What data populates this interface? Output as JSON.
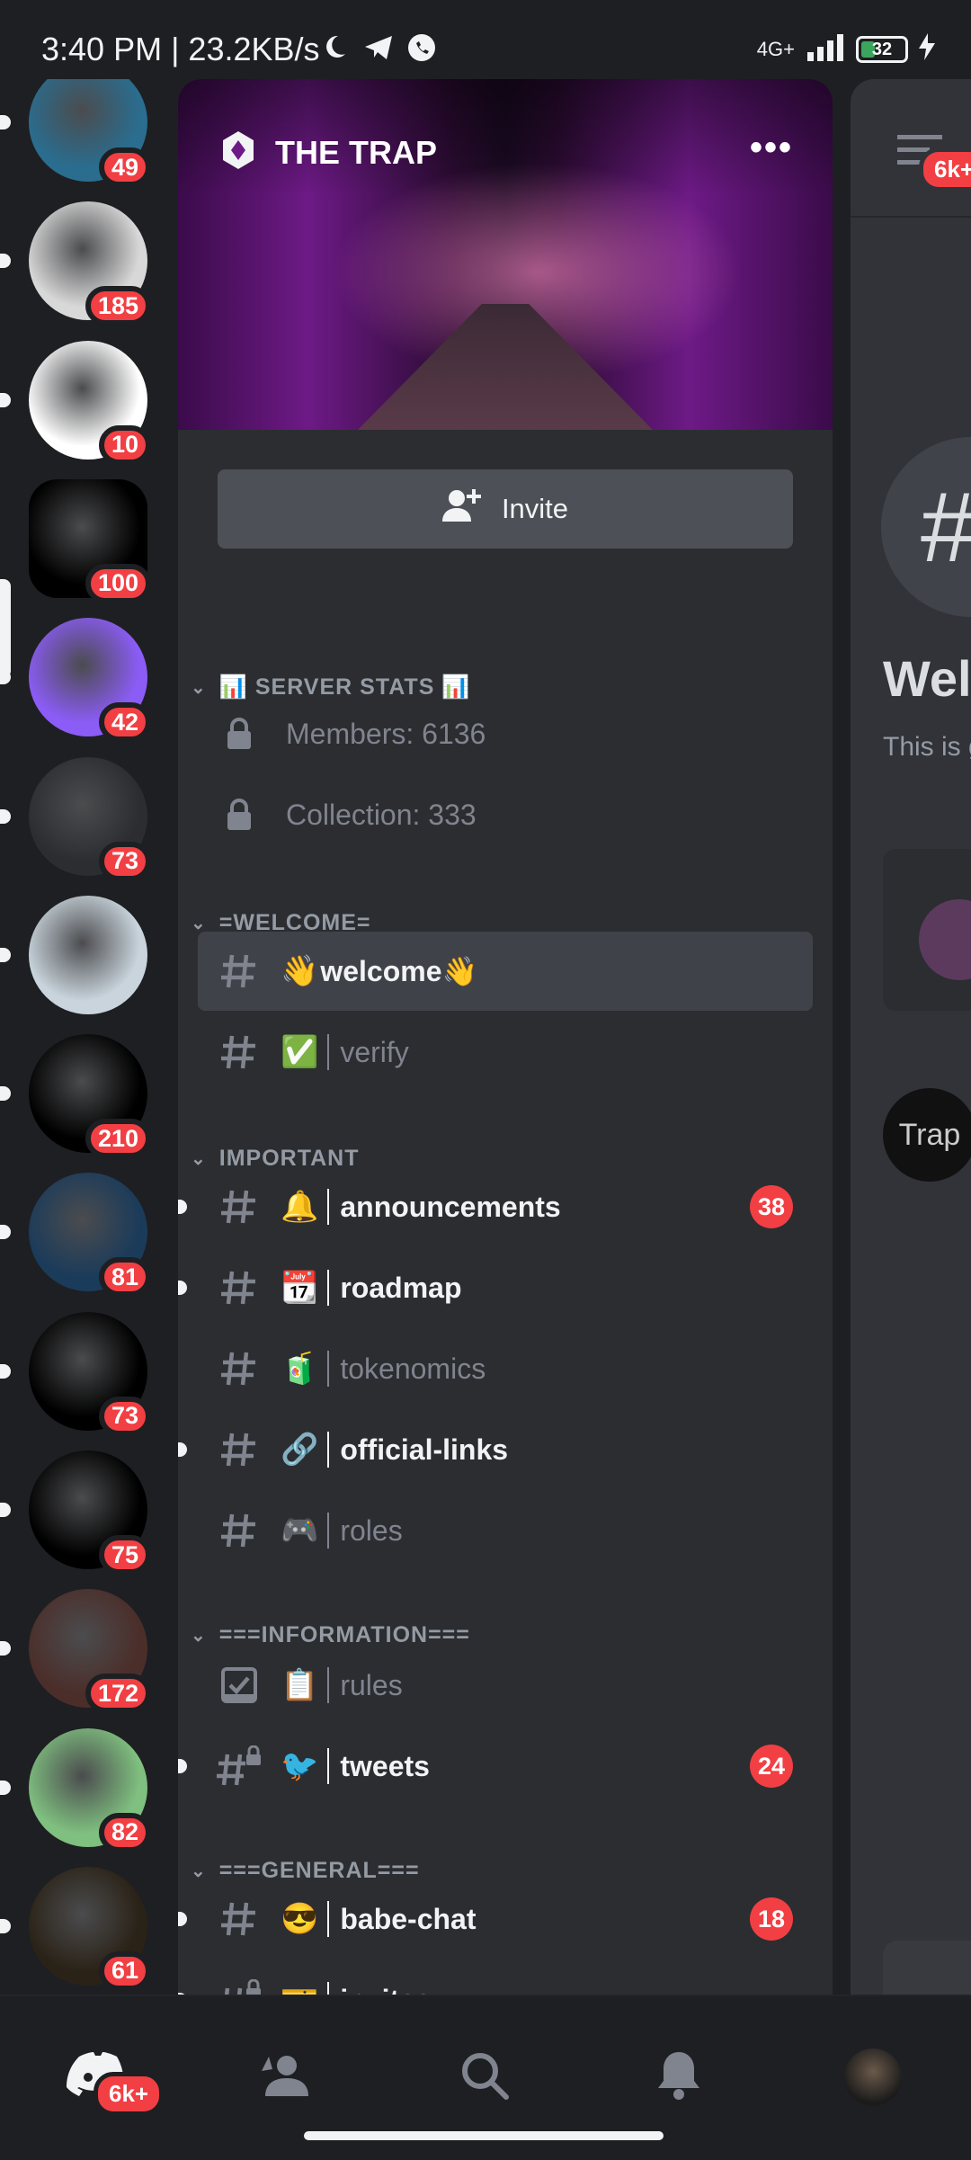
{
  "status_bar": {
    "time_speed": "3:40 PM | 23.2KB/s",
    "network": "4G+",
    "battery": "32",
    "battery_level": 0.32
  },
  "servers": [
    {
      "badge": "49",
      "icon": "avatar-cartoon-headphones",
      "color": "#2a6d8f"
    },
    {
      "badge": "185",
      "icon": "avatar-sketch-logo",
      "color": "#d8d8d8"
    },
    {
      "badge": "10",
      "icon": "avatar-tophat-character",
      "color": "#ffffff"
    },
    {
      "badge": "100",
      "icon": "the-trap-logo",
      "color": "#000000"
    },
    {
      "badge": "42",
      "icon": "purple-flask-logo",
      "color": "#8b5cf6"
    },
    {
      "badge": "73",
      "icon": "pink-blob-logo",
      "color": "#2b2d31"
    },
    {
      "badge": "",
      "icon": "dg-sketch-logo",
      "color": "#c9d4dc"
    },
    {
      "badge": "210",
      "icon": "duf-logo",
      "color": "#000000"
    },
    {
      "badge": "81",
      "icon": "zeus-art",
      "color": "#1b3b5a"
    },
    {
      "badge": "73",
      "icon": "robot-pixel-logo",
      "color": "#000000"
    },
    {
      "badge": "75",
      "icon": "torii-gate-logo",
      "color": "#000000"
    },
    {
      "badge": "172",
      "icon": "king-character",
      "color": "#4b2e2a"
    },
    {
      "badge": "82",
      "icon": "pepe-frog-art",
      "color": "#7fbf7f"
    },
    {
      "badge": "61",
      "icon": "the-wager-logo",
      "color": "#2a2217"
    }
  ],
  "server": {
    "name": "THE TRAP",
    "more": "•••",
    "invite_label": "Invite"
  },
  "categories": [
    {
      "label": "📊 SERVER STATS 📊"
    },
    {
      "label": "=WELCOME="
    },
    {
      "label": "IMPORTANT"
    },
    {
      "label": "===INFORMATION==="
    },
    {
      "label": "===GENERAL==="
    }
  ],
  "channels": [
    {
      "label": "Members: 6136",
      "icon": "lock-icon"
    },
    {
      "label": "Collection: 333",
      "icon": "lock-icon"
    },
    {
      "emoji": "👋",
      "label": "welcome👋"
    },
    {
      "emoji": "✅",
      "label": "verify"
    },
    {
      "emoji": "🔔",
      "label": "announcements",
      "count": "38"
    },
    {
      "emoji": "📆",
      "label": "roadmap"
    },
    {
      "emoji": "🧃",
      "label": "tokenomics"
    },
    {
      "emoji": "🔗",
      "label": "official-links"
    },
    {
      "emoji": "🎮",
      "label": "roles"
    },
    {
      "emoji": "📋",
      "label": "rules"
    },
    {
      "emoji": "🐦",
      "label": "tweets",
      "count": "24"
    },
    {
      "emoji": "😎",
      "label": "babe-chat",
      "count": "18"
    },
    {
      "emoji": "🎫",
      "label": "invites"
    }
  ],
  "chat_preview": {
    "badge": "6k+",
    "hash": "#",
    "title": "Wel",
    "desc": "This is get sta",
    "avatar_text": "Trap"
  },
  "bottom_nav": {
    "home_badge": "6k+"
  },
  "colors": {
    "background": "#1e1f22",
    "panel": "#2b2d31",
    "chat": "#313338",
    "badge_red": "#f23f43",
    "selected": "#404249"
  }
}
